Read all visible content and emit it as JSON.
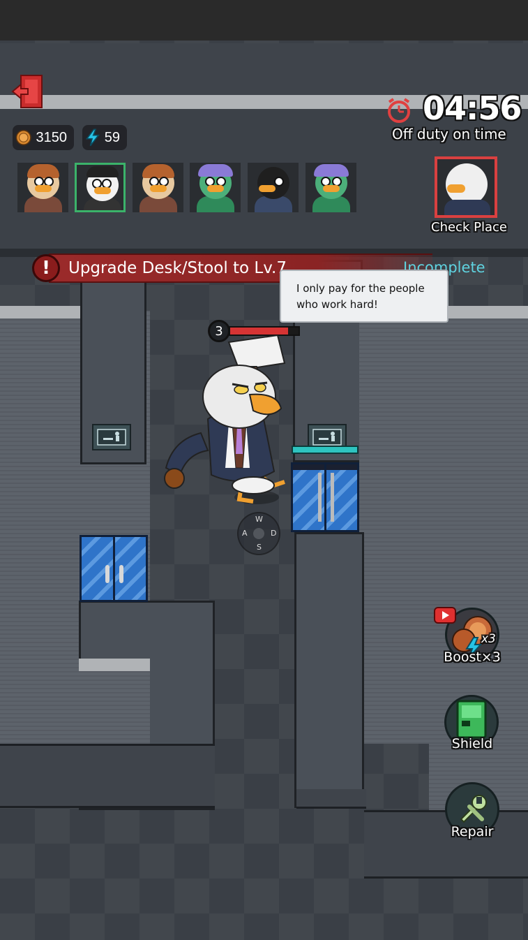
{
  "hud": {
    "coins": "3150",
    "energy": "59",
    "timer": "04:56",
    "timer_subtitle": "Off duty on time",
    "check_place_label": "Check Place"
  },
  "task": {
    "text": "Upgrade Desk/Stool to Lv.7",
    "status": "Incomplete"
  },
  "speech": {
    "text": "I only pay for the people who work hard!"
  },
  "boss": {
    "level": "3",
    "health_fraction": 0.85
  },
  "joystick": {
    "up": "W",
    "left": "A",
    "right": "D",
    "down": "S"
  },
  "actions": {
    "boost_label": "Boost×3",
    "boost_badge": "x3",
    "shield_label": "Shield",
    "repair_label": "Repair"
  },
  "workers": [
    {
      "name": "worker-1",
      "color": "#e0a070"
    },
    {
      "name": "worker-2",
      "color": "#f5f5f5"
    },
    {
      "name": "worker-3",
      "color": "#e0a070"
    },
    {
      "name": "worker-4",
      "color": "#4caf7a"
    },
    {
      "name": "worker-5",
      "color": "#222222"
    },
    {
      "name": "worker-6",
      "color": "#4caf7a"
    }
  ],
  "colors": {
    "task_red": "#9b2a2a",
    "incomplete_cyan": "#5fd3e0",
    "alarm_red": "#e04040",
    "selected_border": "#3bb36a",
    "check_place_border": "#d94040",
    "door_blue": "#2f74c9"
  }
}
